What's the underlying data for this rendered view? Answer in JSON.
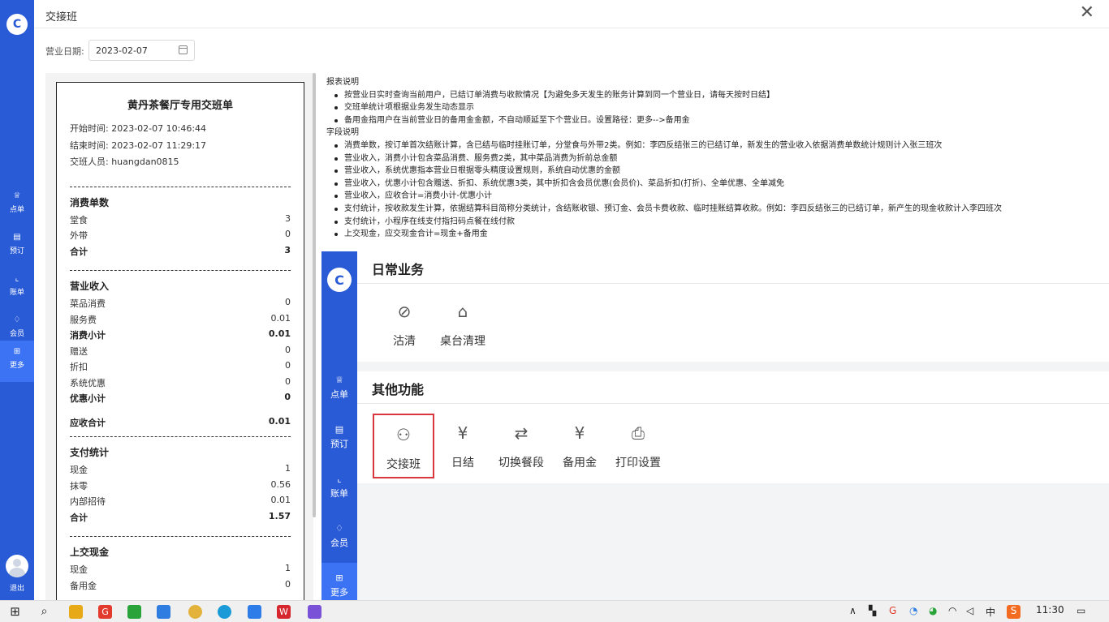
{
  "window": {
    "title": "交接班"
  },
  "sidebar": {
    "items": [
      {
        "icon": "crown-icon",
        "glyph": "♕",
        "label": "点单"
      },
      {
        "icon": "book-icon",
        "glyph": "▤",
        "label": "预订"
      },
      {
        "icon": "chart-icon",
        "glyph": "⌞",
        "label": "账单"
      },
      {
        "icon": "diamond-icon",
        "glyph": "♢",
        "label": "会员"
      },
      {
        "icon": "grid-icon",
        "glyph": "⊞",
        "label": "更多"
      }
    ],
    "exit_label": "退出"
  },
  "date_filter": {
    "label": "营业日期:",
    "value": "2023-02-07"
  },
  "receipt": {
    "title": "黄丹茶餐厅专用交班单",
    "start": "开始时间:  2023-02-07 10:46:44",
    "end": "结束时间:  2023-02-07 11:29:17",
    "staff": "交班人员:  huangdan0815",
    "orders": {
      "title": "消费单数",
      "rows": [
        {
          "label": "堂食",
          "value": "3"
        },
        {
          "label": "外带",
          "value": "0"
        },
        {
          "label": "合计",
          "value": "3"
        }
      ]
    },
    "revenue": {
      "title": "营业收入",
      "rows": [
        {
          "label": "菜品消费",
          "value": "0"
        },
        {
          "label": "服务费",
          "value": "0.01"
        },
        {
          "label": "消费小计",
          "value": "0.01"
        },
        {
          "label": "赠送",
          "value": "0"
        },
        {
          "label": "折扣",
          "value": "0"
        },
        {
          "label": "系统优惠",
          "value": "0"
        },
        {
          "label": "优惠小计",
          "value": "0"
        }
      ],
      "total": {
        "label": "应收合计",
        "value": "0.01"
      }
    },
    "payments": {
      "title": "支付统计",
      "rows": [
        {
          "label": "现金",
          "value": "1"
        },
        {
          "label": "抹零",
          "value": "0.56"
        },
        {
          "label": "内部招待",
          "value": "0.01"
        },
        {
          "label": "合计",
          "value": "1.57"
        }
      ]
    },
    "cash": {
      "title": "上交现金",
      "rows": [
        {
          "label": "现金",
          "value": "1"
        },
        {
          "label": "备用金",
          "value": "0"
        }
      ]
    }
  },
  "explain": {
    "report_title": "报表说明",
    "report_items": [
      "按营业日实时查询当前用户，已结订单消费与收款情况【为避免多天发生的账务计算到同一个营业日，请每天按时日结】",
      "交班单统计项根据业务发生动态显示",
      "备用金指用户在当前营业日的备用金金额，不自动顺延至下个营业日。设置路径：更多-->备用金"
    ],
    "field_title": "字段说明",
    "field_items": [
      "消费单数，按订单首次结账计算，含已结与临时挂账订单，分堂食与外带2类。例如：李四反结张三的已结订单，新发生的营业收入依据消费单数统计规则计入张三班次",
      "营业收入，消费小计包含菜品消费、服务费2类，其中菜品消费为折前总金额",
      "营业收入，系统优惠指本营业日根据零头精度设置规则，系统自动优惠的金额",
      "营业收入，优惠小计包含赠送、折扣、系统优惠3类，其中折扣含会员优惠(会员价)、菜品折扣(打折)、全单优惠、全单减免",
      "营业收入，应收合计=消费小计-优惠小计",
      "支付统计，按收款发生计算，依据结算科目简称分类统计，含结账收银、预订金、会员卡费收款、临时挂账结算收款。例如：李四反结张三的已结订单，新产生的现金收款计入李四班次",
      "支付统计，小程序在线支付指扫码点餐在线付款",
      "上交现金，应交现金合计=现金+备用金"
    ]
  },
  "embedded": {
    "sidebar": [
      {
        "icon": "crown-icon",
        "glyph": "♕",
        "label": "点单"
      },
      {
        "icon": "book-icon",
        "glyph": "▤",
        "label": "预订"
      },
      {
        "icon": "chart-icon",
        "glyph": "⌞",
        "label": "账单"
      },
      {
        "icon": "diamond-icon",
        "glyph": "♢",
        "label": "会员"
      },
      {
        "icon": "grid-icon",
        "glyph": "⊞",
        "label": "更多"
      }
    ],
    "daily": {
      "title": "日常业务",
      "tiles": [
        {
          "icon": "tag-icon",
          "glyph": "⊘",
          "label": "沽清"
        },
        {
          "icon": "broom-icon",
          "glyph": "⌂",
          "label": "桌台清理"
        }
      ]
    },
    "other": {
      "title": "其他功能",
      "tiles": [
        {
          "icon": "user-swap-icon",
          "glyph": "⚇",
          "label": "交接班"
        },
        {
          "icon": "yen-circle-icon",
          "glyph": "¥",
          "label": "日结"
        },
        {
          "icon": "switch-icon",
          "glyph": "⇄",
          "label": "切换餐段"
        },
        {
          "icon": "wallet-icon",
          "glyph": "¥",
          "label": "备用金"
        },
        {
          "icon": "printer-icon",
          "glyph": "⎙",
          "label": "打印设置"
        }
      ]
    }
  },
  "taskbar": {
    "time": "11:30",
    "ime": "中",
    "sogou": "S"
  }
}
